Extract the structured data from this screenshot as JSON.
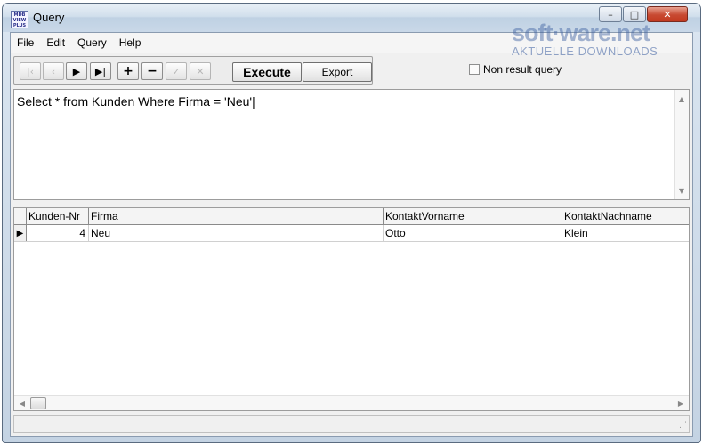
{
  "window": {
    "title": "Query",
    "app_icon_text": "MDB VIEW PLUS",
    "controls": {
      "minimize": "–",
      "maximize": "□",
      "close": "✕"
    }
  },
  "menu": [
    "File",
    "Edit",
    "Query",
    "Help"
  ],
  "toolbar": {
    "nav_first": "|‹",
    "nav_prev": "‹",
    "nav_next": "▶",
    "nav_last": "▶|",
    "add": "+",
    "remove": "−",
    "post": "✓",
    "cancel": "✕",
    "execute_label": "Execute",
    "export_label": "Export"
  },
  "options": {
    "non_result_query_label": "Non result query",
    "non_result_query_checked": false
  },
  "watermark": {
    "logo": "soft·ware.net",
    "sub": "AKTUELLE DOWNLOADS"
  },
  "sql": {
    "text": "Select * from Kunden Where Firma = 'Neu'|"
  },
  "grid": {
    "columns": [
      "Kunden-Nr",
      "Firma",
      "KontaktVorname",
      "KontaktNachname"
    ],
    "rows": [
      {
        "kunden_nr": "4",
        "firma": "Neu",
        "vorname": "Otto",
        "nachname": "Klein",
        "current_marker": "▶"
      }
    ]
  },
  "scroll": {
    "up": "▲",
    "down": "▼",
    "left": "◀",
    "right": "▶"
  }
}
